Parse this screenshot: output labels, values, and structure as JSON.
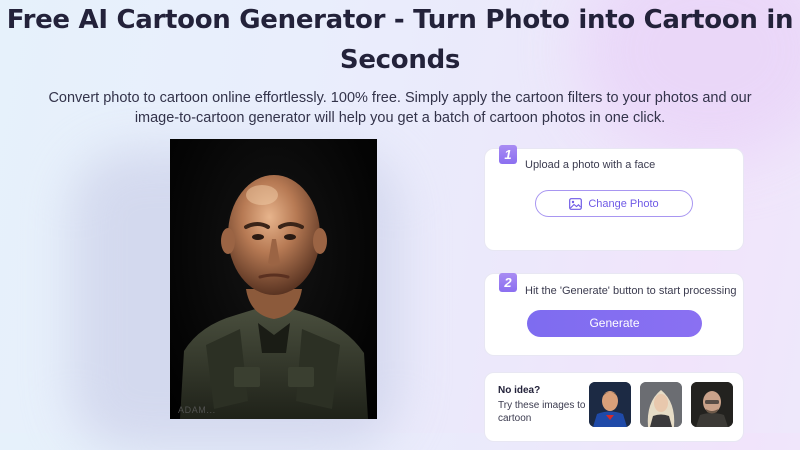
{
  "hero": {
    "title": "Free AI Cartoon Generator - Turn Photo into Cartoon in Seconds",
    "subtitle_line1": "Convert photo to cartoon online effortlessly. 100% free. Simply apply the cartoon filters to your photos and our",
    "subtitle_line2": "image-to-cartoon generator will help you get a batch of cartoon photos in one click."
  },
  "preview": {
    "watermark": "ADAM..."
  },
  "steps": [
    {
      "number": "1",
      "text": "Upload a photo with a face",
      "button_label": "Change Photo",
      "button_icon": "image-icon"
    },
    {
      "number": "2",
      "text": "Hit the 'Generate' button to start processing",
      "button_label": "Generate"
    }
  ],
  "try_samples": {
    "title": "No idea?",
    "text": "Try these images to cartoon",
    "thumbnails": [
      "superhero-thumb",
      "woman-thumb",
      "bald-man-thumb"
    ]
  },
  "colors": {
    "accent": "#7e6cf0",
    "title": "#23223a"
  }
}
